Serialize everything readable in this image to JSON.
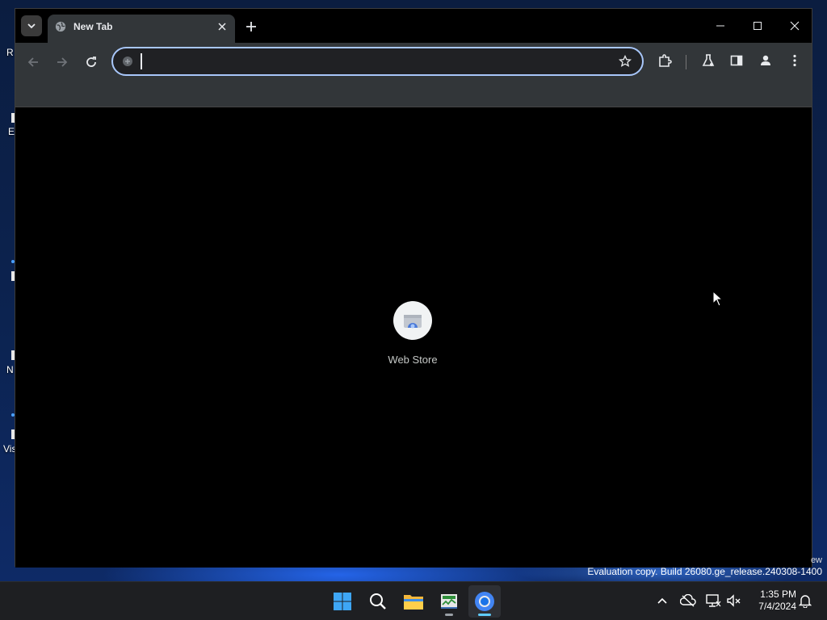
{
  "desktop": {
    "icons": [
      {
        "label": "R"
      },
      {
        "label": "E"
      },
      {
        "label": "N"
      },
      {
        "label": "Vis"
      }
    ]
  },
  "browser": {
    "tab": {
      "title": "New Tab",
      "favicon": "globe-icon"
    },
    "toolbar": {
      "back": "arrow-left-icon",
      "forward": "arrow-right-icon",
      "reload": "reload-icon",
      "omnibox_value": "",
      "bookmark": "star-icon",
      "extensions": "puzzle-icon",
      "labs": "flask-icon",
      "side_panel": "side-panel-icon",
      "profile": "person-icon",
      "menu": "kebab-menu-icon"
    },
    "content": {
      "shortcuts": [
        {
          "label": "Web Store",
          "icon": "web-store-icon"
        }
      ]
    }
  },
  "watermark": {
    "top": "ew",
    "text": "Evaluation copy. Build 26080.ge_release.240308-1400"
  },
  "taskbar": {
    "apps": [
      "start",
      "search",
      "file-explorer",
      "task-manager",
      "chrome"
    ],
    "clock": {
      "time": "1:35 PM",
      "date": "7/4/2024"
    }
  },
  "colors": {
    "accent": "#a8c7fa",
    "toolbar_bg": "#323639",
    "taskbar_bg": "#1e1f22"
  }
}
